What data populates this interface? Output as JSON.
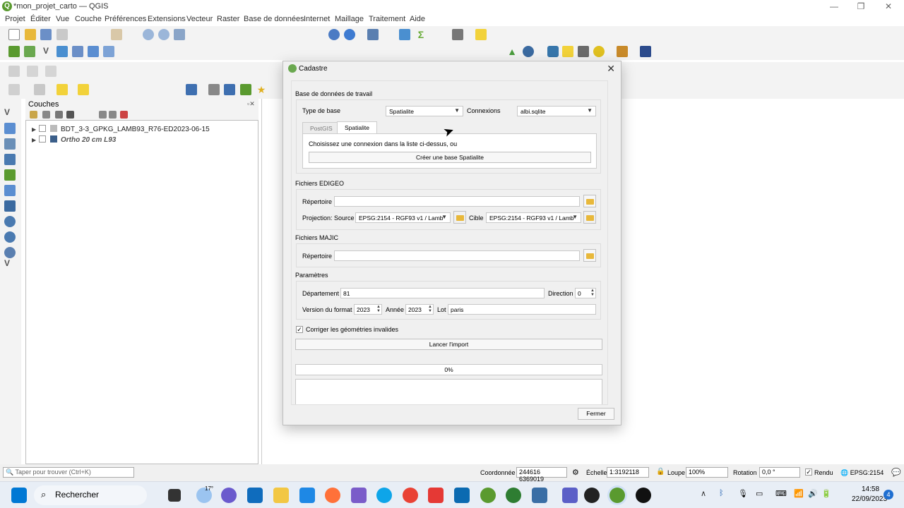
{
  "window": {
    "title": "*mon_projet_carto — QGIS"
  },
  "menu": [
    "Projet",
    "Éditer",
    "Vue",
    "Couche",
    "Préférences",
    "Extensions",
    "Vecteur",
    "Raster",
    "Base de données",
    "Internet",
    "Maillage",
    "Traitement",
    "Aide"
  ],
  "layers_panel": {
    "title": "Couches",
    "layers": [
      {
        "name": "BDT_3-3_GPKG_LAMB93_R76-ED2023-06-15"
      },
      {
        "name": "Ortho 20 cm L93"
      }
    ]
  },
  "dialog": {
    "title": "Cadastre",
    "db_section": "Base de données de travail",
    "db_type_label": "Type de base",
    "db_type_value": "Spatialite",
    "connexions_label": "Connexions",
    "connexions_value": "albi.sqlite",
    "tabs": [
      "PostGIS",
      "Spatialite"
    ],
    "choose_text": "Choisissez une connexion dans la liste ci-dessus, ou",
    "create_button": "Créer une base Spatialite",
    "edigeo_section": "Fichiers EDIGEO",
    "repertoire_label": "Répertoire",
    "projection_label": "Projection: Source",
    "source_value": "EPSG:2154 - RGF93 v1 / Lamb",
    "cible_label": "Cible",
    "cible_value": "EPSG:2154 - RGF93 v1 / Lamb",
    "majic_section": "Fichiers MAJIC",
    "majic_rep_label": "Répertoire",
    "params_section": "Paramètres",
    "departement_label": "Département",
    "departement_value": "81",
    "direction_label": "Direction",
    "direction_value": "0",
    "version_label": "Version du format",
    "version_value": "2023",
    "annee_label": "Année",
    "annee_value": "2023",
    "lot_label": "Lot",
    "lot_value": "paris",
    "corriger_label": "Corriger les géométries invalides",
    "lancer_button": "Lancer l'import",
    "progress_text": "0%",
    "progress": 0,
    "fermer_button": "Fermer"
  },
  "statusbar": {
    "search_placeholder": "Taper pour trouver (Ctrl+K)",
    "coord_label": "Coordonnée",
    "coord_value": "244616 6369019",
    "echelle_label": "Échelle",
    "echelle_value": "1:3192118",
    "loupe_label": "Loupe",
    "loupe_value": "100%",
    "rotation_label": "Rotation",
    "rotation_value": "0,0 °",
    "rendu_label": "Rendu",
    "crs": "EPSG:2154"
  },
  "taskbar": {
    "search_label": "Rechercher",
    "weather": "17°",
    "time": "14:58",
    "date": "22/09/2023",
    "notif_count": "4"
  },
  "colors": {
    "qgis_green": "#5a9a2f",
    "folder": "#e8b83a",
    "accent": "#0078d4"
  }
}
